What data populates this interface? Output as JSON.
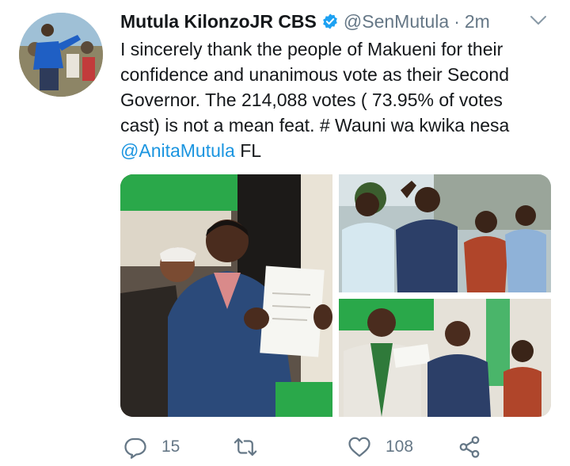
{
  "tweet": {
    "display_name": "Mutula KilonzoJR CBS",
    "handle": "@SenMutula",
    "separator": "·",
    "timestamp": "2m",
    "text_lines": [
      "I sincerely thank the people of Makueni  for their",
      "confidence and unanimous vote as their Second",
      "Governor.  The 214,088 votes ( 73.95% of votes",
      "cast) is not a mean feat. # Wauni wa kwika nesa"
    ],
    "mention": "@AnitaMutula",
    "trailing_text": " FL",
    "photos": [
      {
        "name": "photo-main"
      },
      {
        "name": "photo-top-right"
      },
      {
        "name": "photo-bottom-right"
      }
    ]
  },
  "actions": {
    "reply_count": "15",
    "retweet_count": "",
    "like_count": "108"
  },
  "colors": {
    "text": "#14171a",
    "secondary": "#657786",
    "link": "#1b95e0",
    "verified": "#1da1f2"
  },
  "icons": [
    "verified-badge-icon",
    "chevron-down-icon",
    "reply-icon",
    "retweet-icon",
    "like-icon",
    "share-icon"
  ]
}
